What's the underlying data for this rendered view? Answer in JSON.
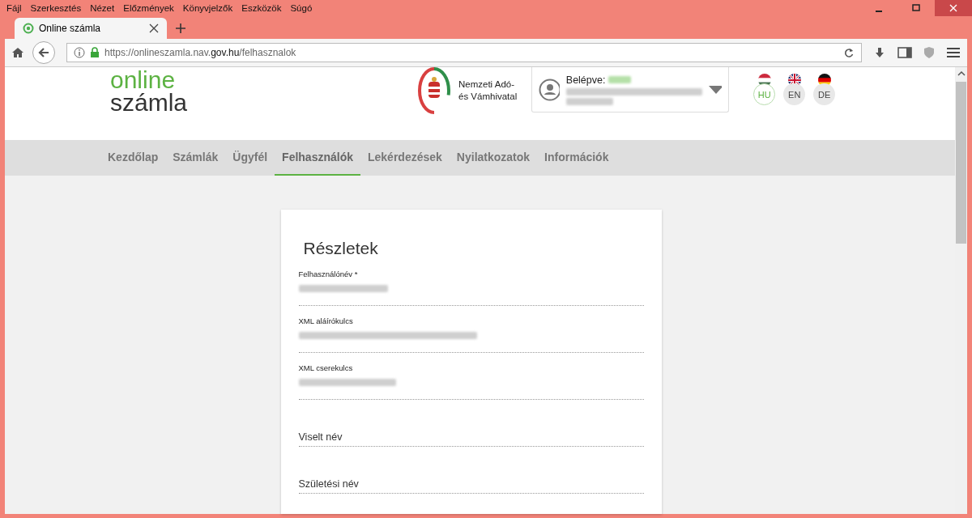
{
  "menu_bar": [
    "Fájl",
    "Szerkesztés",
    "Nézet",
    "Előzmények",
    "Könyvjelzők",
    "Eszközök",
    "Súgó"
  ],
  "browser_tab": {
    "title": "Online számla",
    "selected": true
  },
  "address_bar": {
    "url_start": "https://onlineszamla.nav.",
    "url_domain": "gov.hu",
    "url_path": "/felhasznalok"
  },
  "logo": {
    "line1": "online",
    "line2": "számla"
  },
  "agency": {
    "line1": "Nemzeti Adó-",
    "line2": "és Vámhivatal"
  },
  "user_menu": {
    "label": "Belépve:"
  },
  "languages": [
    {
      "code": "HU",
      "kind": "hu",
      "selected": true
    },
    {
      "code": "EN",
      "kind": "gb",
      "selected": false
    },
    {
      "code": "DE",
      "kind": "de",
      "selected": false
    }
  ],
  "nav": [
    {
      "label": "Kezdőlap",
      "selected": false
    },
    {
      "label": "Számlák",
      "selected": false
    },
    {
      "label": "Ügyfél",
      "selected": false
    },
    {
      "label": "Felhasználók",
      "selected": true
    },
    {
      "label": "Lekérdezések",
      "selected": false
    },
    {
      "label": "Nyilatkozatok",
      "selected": false
    },
    {
      "label": "Információk",
      "selected": false
    }
  ],
  "card": {
    "title": "Részletek",
    "fields": [
      {
        "label": "Felhasználónév *",
        "kind": "redacted"
      },
      {
        "label": "XML aláírókulcs",
        "kind": "redacted"
      },
      {
        "label": "XML cserekulcs",
        "kind": "redacted"
      },
      {
        "label": "Viselt név",
        "kind": "empty"
      },
      {
        "label": "Születési név",
        "kind": "empty"
      }
    ]
  }
}
